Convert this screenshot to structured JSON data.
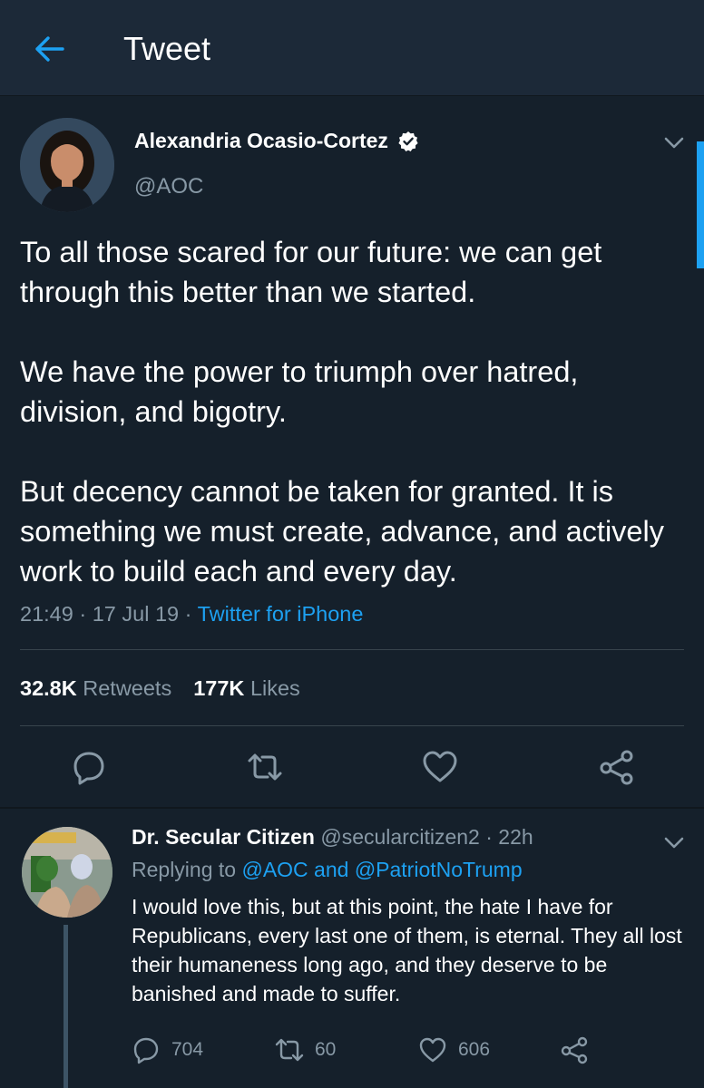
{
  "header": {
    "title": "Tweet",
    "back_icon": "arrow-left-icon",
    "accent": "#1da1f2",
    "background": "#1c2938"
  },
  "tweet": {
    "author_name": "Alexandria Ocasio-Cortez",
    "author_handle": "@AOC",
    "verified": true,
    "paragraphs": [
      "To all those scared for our future: we can get through this better than we started.",
      "We have the power to triumph over hatred, division, and bigotry.",
      "But decency cannot be taken for granted. It is something we must create, advance, and actively work to build each and every day."
    ],
    "time": "21:49",
    "date": "17 Jul 19",
    "meta_sep": "·",
    "source": "Twitter for iPhone",
    "retweets_count": "32.8K",
    "retweets_label": "Retweets",
    "likes_count": "177K",
    "likes_label": "Likes",
    "actions": [
      "reply-icon",
      "retweet-icon",
      "like-icon",
      "share-icon"
    ]
  },
  "reply": {
    "author_name": "Dr. Secular Citizen",
    "author_handle": "@secularcitizen2",
    "time_sep": "·",
    "time": "22h",
    "replying_prefix": "Replying to",
    "mentions": "@AOC and @PatriotNoTrump",
    "text": "I would love this, but at this point, the hate I have for Republicans, every last one of them, is eternal. They all lost their humaneness long ago, and they deserve to be banished and made to suffer.",
    "replies": "704",
    "retweets": "60",
    "likes": "606"
  },
  "colors": {
    "background": "#15202b",
    "secondary_text": "#8899a6",
    "link": "#1da1f2",
    "divider": "#38444d"
  }
}
